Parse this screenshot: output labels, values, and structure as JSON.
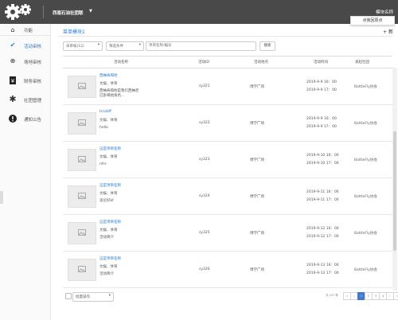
{
  "header": {
    "org_name": "西南石油社团联",
    "account_name": "模块名称",
    "tooltip": "点我回原点"
  },
  "sidebar": {
    "items": [
      {
        "label": "功能",
        "icon": "home-icon"
      },
      {
        "label": "活动审核",
        "icon": "check-icon"
      },
      {
        "label": "场地审核",
        "icon": "globe-icon"
      },
      {
        "label": "财务审核",
        "icon": "money-icon"
      },
      {
        "label": "社团管理",
        "icon": "asterisk-icon"
      },
      {
        "label": "通知公告",
        "icon": "alert-icon"
      }
    ]
  },
  "panel": {
    "title": "菜单模块1",
    "add_label": "+ 新"
  },
  "filters": {
    "status": "未审核(12)",
    "condition": "筛选条件",
    "search_placeholder": "项目名称/编号",
    "search_button": "搜索"
  },
  "table": {
    "headers": [
      "活动名称",
      "活动ID",
      "活动地点",
      "活动时间",
      "发起社团"
    ],
    "rows": [
      {
        "title": "西柚寿喝他",
        "sub": "文娱、体育",
        "desc": "西柚寿喝他是我们西柚老已卧喝他角色...",
        "id": "sy321",
        "place": "博学广场",
        "start": "2019-9-9 16：00",
        "end": "2019-9-9 17：00",
        "community": "BattleFly协会"
      },
      {
        "title": "tcszbff",
        "sub": "文娱、体育",
        "desc": "hello",
        "id": "sy322",
        "place": "博学广场",
        "start": "2019-9-9 16：00",
        "end": "2019-9-9 17：00",
        "community": "BattleFly协会"
      },
      {
        "title": "这是项目名称",
        "sub": "文娱、体育",
        "desc": "nfrs",
        "id": "sy323",
        "place": "博学广场",
        "start": "2019-9-10 16：00",
        "end": "2019-9-10 17：00",
        "community": "BattleFly协会"
      },
      {
        "title": "这是项目名称",
        "sub": "文娱、体育",
        "desc": "谈论好kf",
        "id": "sy324",
        "place": "博学广场",
        "start": "2019-9-11 16：00",
        "end": "2019-9-11 17：00",
        "community": "BattleFly协会"
      },
      {
        "title": "这是项目名称",
        "sub": "文娱、体育",
        "desc": "活动简介",
        "id": "sy325",
        "place": "博学广场",
        "start": "2019-9-12 16：00",
        "end": "2019-9-12 17：00",
        "community": "BattleFly协会"
      },
      {
        "title": "这是项目名称",
        "sub": "文娱、体育",
        "desc": "活动简介",
        "id": "sy326",
        "place": "博学广场",
        "start": "2019-9-13 16：00",
        "end": "2019-9-13 17：00",
        "community": "BattleFly协会"
      }
    ]
  },
  "footer": {
    "bulk_action": "批量操作",
    "total": "共 107 条",
    "pages": [
      "«",
      "‹",
      "1",
      "2",
      "3",
      "4",
      "›",
      "»"
    ],
    "active_page": "1"
  }
}
